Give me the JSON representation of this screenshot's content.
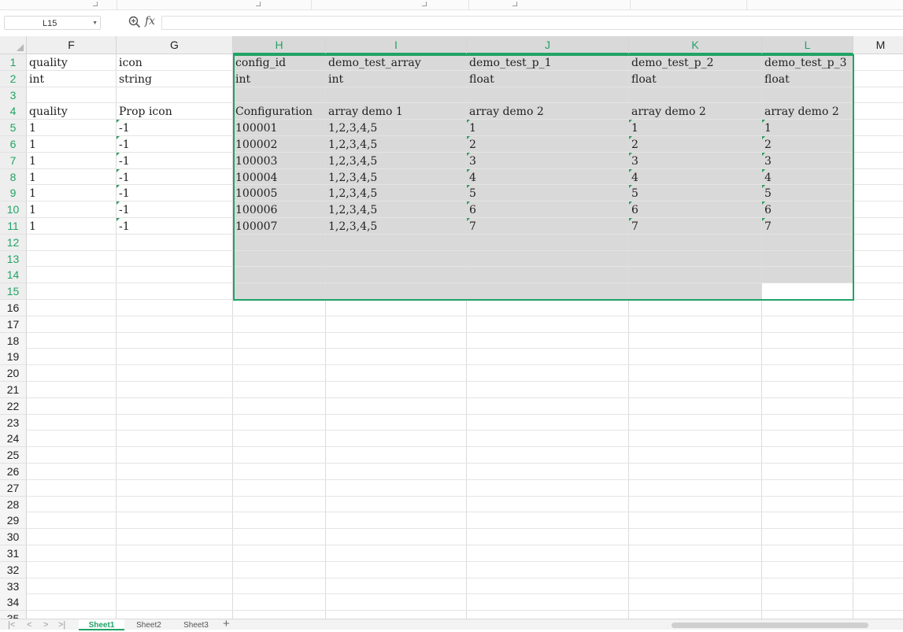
{
  "formula_bar": {
    "name_box": "L15",
    "fx": "fx",
    "formula": ""
  },
  "columns": [
    {
      "id": "F",
      "selected": false
    },
    {
      "id": "G",
      "selected": false
    },
    {
      "id": "H",
      "selected": true
    },
    {
      "id": "I",
      "selected": true
    },
    {
      "id": "J",
      "selected": true
    },
    {
      "id": "K",
      "selected": true
    },
    {
      "id": "L",
      "selected": true
    },
    {
      "id": "M",
      "selected": false
    }
  ],
  "rows": [
    "1",
    "2",
    "3",
    "4",
    "5",
    "6",
    "7",
    "8",
    "9",
    "10",
    "11",
    "12",
    "13",
    "14",
    "15",
    "16",
    "17",
    "18",
    "19",
    "20",
    "21",
    "22",
    "23",
    "24",
    "25",
    "26",
    "27",
    "28",
    "29",
    "30",
    "31",
    "32",
    "33",
    "34",
    "35"
  ],
  "selected_rows_last": 15,
  "cells": [
    [
      "quality",
      "icon",
      "config_id",
      "demo_test_array",
      "demo_test_p_1",
      "demo_test_p_2",
      "demo_test_p_3"
    ],
    [
      "int",
      "string",
      "int",
      "int",
      "float",
      "float",
      "float"
    ],
    [
      "",
      "",
      "",
      "",
      "",
      "",
      ""
    ],
    [
      "quality",
      "Prop icon",
      "Configuration",
      "array demo 1",
      "array demo 2",
      "array demo 2",
      "array demo 2"
    ],
    [
      "1",
      "-1",
      "100001",
      "1,2,3,4,5",
      "1",
      "1",
      "1"
    ],
    [
      "1",
      "-1",
      "100002",
      "1,2,3,4,5",
      "2",
      "2",
      "2"
    ],
    [
      "1",
      "-1",
      "100003",
      "1,2,3,4,5",
      "3",
      "3",
      "3"
    ],
    [
      "1",
      "-1",
      "100004",
      "1,2,3,4,5",
      "4",
      "4",
      "4"
    ],
    [
      "1",
      "-1",
      "100005",
      "1,2,3,4,5",
      "5",
      "5",
      "5"
    ],
    [
      "1",
      "-1",
      "100006",
      "1,2,3,4,5",
      "6",
      "6",
      "6"
    ],
    [
      "1",
      "-1",
      "100007",
      "1,2,3,4,5",
      "7",
      "7",
      "7"
    ]
  ],
  "sheets": [
    {
      "label": "Sheet1",
      "active": true
    },
    {
      "label": "Sheet2",
      "active": false
    },
    {
      "label": "Sheet3",
      "active": false
    }
  ],
  "add_sheet_label": "+",
  "nav": {
    "first": "|<",
    "prev": "<",
    "next": ">",
    "last": ">|"
  },
  "colors": {
    "accent": "#21a366",
    "selection": "#d9d9d9"
  }
}
